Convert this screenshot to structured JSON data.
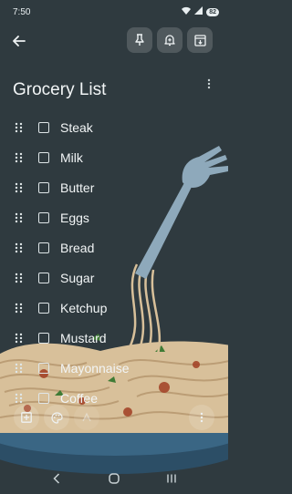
{
  "status_bar": {
    "time": "7:50",
    "battery": "82"
  },
  "note": {
    "title": "Grocery List",
    "items": [
      {
        "label": "Steak",
        "checked": false
      },
      {
        "label": "Milk",
        "checked": false
      },
      {
        "label": "Butter",
        "checked": false
      },
      {
        "label": "Eggs",
        "checked": false
      },
      {
        "label": "Bread",
        "checked": false
      },
      {
        "label": "Sugar",
        "checked": false
      },
      {
        "label": "Ketchup",
        "checked": false
      },
      {
        "label": "Mustard",
        "checked": false
      },
      {
        "label": "Mayonnaise",
        "checked": false
      },
      {
        "label": "Coffee",
        "checked": false
      }
    ]
  },
  "icons": {
    "back": "back-arrow-icon",
    "pin": "pin-icon",
    "reminder": "bell-plus-icon",
    "archive": "archive-icon",
    "add": "add-box-icon",
    "palette": "palette-icon",
    "format": "text-format-icon",
    "more": "more-vertical-icon"
  },
  "colors": {
    "background": "#2f3a3f",
    "text": "#f2f5f6"
  }
}
